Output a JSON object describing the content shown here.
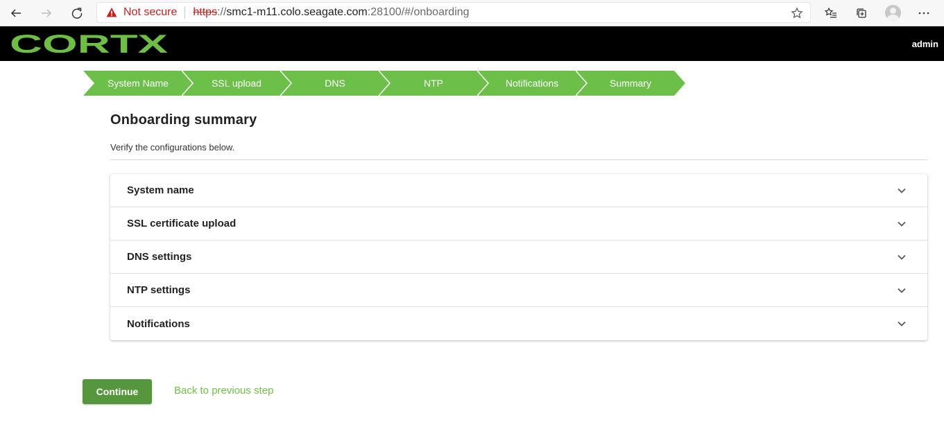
{
  "browser": {
    "security_label": "Not secure",
    "url_scheme": "https",
    "url_sep": "://",
    "url_host": "smc1-m11.colo.seagate.com",
    "url_path": ":28100/#/onboarding",
    "icons": [
      "back-arrow-icon",
      "forward-arrow-icon",
      "refresh-icon",
      "warning-icon",
      "star-icon",
      "favorites-icon",
      "collections-icon",
      "profile-icon",
      "more-icon"
    ]
  },
  "header": {
    "logo_text": "CORTX",
    "user": "admin",
    "background": "#000000",
    "logo_color": "#6ebe46"
  },
  "stepper": {
    "color": "#6cc04a",
    "steps": [
      {
        "label": "System Name"
      },
      {
        "label": "SSL upload"
      },
      {
        "label": "DNS"
      },
      {
        "label": "NTP"
      },
      {
        "label": "Notifications"
      },
      {
        "label": "Summary"
      }
    ]
  },
  "main": {
    "title": "Onboarding summary",
    "subtitle": "Verify the configurations below.",
    "sections": [
      {
        "label": "System name"
      },
      {
        "label": "SSL certificate upload"
      },
      {
        "label": "DNS settings"
      },
      {
        "label": "NTP settings"
      },
      {
        "label": "Notifications"
      }
    ]
  },
  "actions": {
    "continue_label": "Continue",
    "back_label": "Back to previous step",
    "primary_color": "#56963c",
    "link_color": "#6ebe46"
  }
}
